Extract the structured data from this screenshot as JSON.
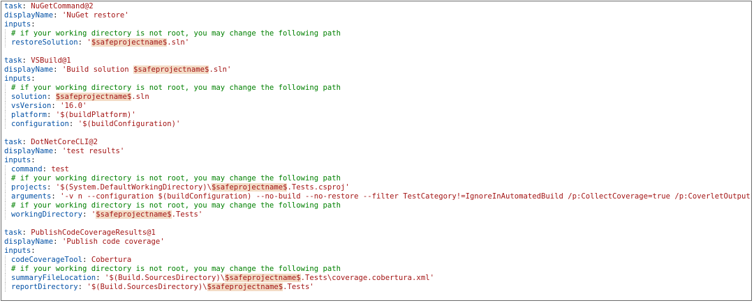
{
  "code_lines": [
    [
      {
        "t": "k",
        "v": "task"
      },
      {
        "t": "p",
        "v": ": "
      },
      {
        "t": "s",
        "v": "NuGetCommand@2"
      }
    ],
    [
      {
        "t": "k",
        "v": "displayName"
      },
      {
        "t": "p",
        "v": ": "
      },
      {
        "t": "s",
        "v": "'NuGet restore'"
      }
    ],
    [
      {
        "t": "k",
        "v": "inputs"
      },
      {
        "t": "p",
        "v": ":"
      }
    ],
    [
      {
        "t": "i"
      },
      {
        "t": "c",
        "v": "# if your working directory is not root, you may change the following path"
      }
    ],
    [
      {
        "t": "i"
      },
      {
        "t": "k",
        "v": "restoreSolution"
      },
      {
        "t": "p",
        "v": ": "
      },
      {
        "t": "s",
        "v": "'"
      },
      {
        "t": "v",
        "v": "$safeprojectname$"
      },
      {
        "t": "s",
        "v": ".sln'"
      }
    ],
    [],
    [
      {
        "t": "k",
        "v": "task"
      },
      {
        "t": "p",
        "v": ": "
      },
      {
        "t": "s",
        "v": "VSBuild@1"
      }
    ],
    [
      {
        "t": "k",
        "v": "displayName"
      },
      {
        "t": "p",
        "v": ": "
      },
      {
        "t": "s",
        "v": "'Build solution "
      },
      {
        "t": "v",
        "v": "$safeprojectname$"
      },
      {
        "t": "s",
        "v": ".sln'"
      }
    ],
    [
      {
        "t": "k",
        "v": "inputs"
      },
      {
        "t": "p",
        "v": ":"
      }
    ],
    [
      {
        "t": "i"
      },
      {
        "t": "c",
        "v": "# if your working directory is not root, you may change the following path"
      }
    ],
    [
      {
        "t": "i"
      },
      {
        "t": "k",
        "v": "solution"
      },
      {
        "t": "p",
        "v": ": "
      },
      {
        "t": "v",
        "v": "$safeprojectname$"
      },
      {
        "t": "s",
        "v": ".sln"
      }
    ],
    [
      {
        "t": "i"
      },
      {
        "t": "k",
        "v": "vsVersion"
      },
      {
        "t": "p",
        "v": ": "
      },
      {
        "t": "s",
        "v": "'16.0'"
      }
    ],
    [
      {
        "t": "i"
      },
      {
        "t": "k",
        "v": "platform"
      },
      {
        "t": "p",
        "v": ": "
      },
      {
        "t": "s",
        "v": "'$(buildPlatform)'"
      }
    ],
    [
      {
        "t": "i"
      },
      {
        "t": "k",
        "v": "configuration"
      },
      {
        "t": "p",
        "v": ": "
      },
      {
        "t": "s",
        "v": "'$(buildConfiguration)'"
      }
    ],
    [],
    [
      {
        "t": "k",
        "v": "task"
      },
      {
        "t": "p",
        "v": ": "
      },
      {
        "t": "s",
        "v": "DotNetCoreCLI@2"
      }
    ],
    [
      {
        "t": "k",
        "v": "displayName"
      },
      {
        "t": "p",
        "v": ": "
      },
      {
        "t": "s",
        "v": "'test results'"
      }
    ],
    [
      {
        "t": "k",
        "v": "inputs"
      },
      {
        "t": "p",
        "v": ":"
      }
    ],
    [
      {
        "t": "i"
      },
      {
        "t": "k",
        "v": "command"
      },
      {
        "t": "p",
        "v": ": "
      },
      {
        "t": "s",
        "v": "test"
      }
    ],
    [
      {
        "t": "i"
      },
      {
        "t": "c",
        "v": "# if your working directory is not root, you may change the following path"
      }
    ],
    [
      {
        "t": "i"
      },
      {
        "t": "k",
        "v": "projects"
      },
      {
        "t": "p",
        "v": ": "
      },
      {
        "t": "s",
        "v": "'$(System.DefaultWorkingDirectory)\\"
      },
      {
        "t": "v",
        "v": "$safeprojectname$"
      },
      {
        "t": "s",
        "v": ".Tests.csproj'"
      }
    ],
    [
      {
        "t": "i"
      },
      {
        "t": "k",
        "v": "arguments"
      },
      {
        "t": "p",
        "v": ": "
      },
      {
        "t": "s",
        "v": "'-v n --configuration $(buildConfiguration) --no-build --no-restore --filter TestCategory!=IgnoreInAutomatedBuild /p:CollectCoverage=true /p:CoverletOutputFormat=cobertura'"
      }
    ],
    [
      {
        "t": "i"
      },
      {
        "t": "c",
        "v": "# if your working directory is not root, you may change the following path"
      }
    ],
    [
      {
        "t": "i"
      },
      {
        "t": "k",
        "v": "workingDirectory"
      },
      {
        "t": "p",
        "v": ": "
      },
      {
        "t": "s",
        "v": "'"
      },
      {
        "t": "v",
        "v": "$safeprojectname$"
      },
      {
        "t": "s",
        "v": ".Tests'"
      }
    ],
    [],
    [
      {
        "t": "k",
        "v": "task"
      },
      {
        "t": "p",
        "v": ": "
      },
      {
        "t": "s",
        "v": "PublishCodeCoverageResults@1"
      }
    ],
    [
      {
        "t": "k",
        "v": "displayName"
      },
      {
        "t": "p",
        "v": ": "
      },
      {
        "t": "s",
        "v": "'Publish code coverage'"
      }
    ],
    [
      {
        "t": "k",
        "v": "inputs"
      },
      {
        "t": "p",
        "v": ":"
      }
    ],
    [
      {
        "t": "i"
      },
      {
        "t": "k",
        "v": "codeCoverageTool"
      },
      {
        "t": "p",
        "v": ": "
      },
      {
        "t": "s",
        "v": "Cobertura"
      }
    ],
    [
      {
        "t": "i"
      },
      {
        "t": "c",
        "v": "# if your working directory is not root, you may change the following path"
      }
    ],
    [
      {
        "t": "i"
      },
      {
        "t": "k",
        "v": "summaryFileLocation"
      },
      {
        "t": "p",
        "v": ": "
      },
      {
        "t": "s",
        "v": "'$(Build.SourcesDirectory)\\"
      },
      {
        "t": "v",
        "v": "$safeprojectname$"
      },
      {
        "t": "s",
        "v": ".Tests\\coverage.cobertura.xml'"
      }
    ],
    [
      {
        "t": "i"
      },
      {
        "t": "k",
        "v": "reportDirectory"
      },
      {
        "t": "p",
        "v": ": "
      },
      {
        "t": "s",
        "v": "'$(Build.SourcesDirectory)\\"
      },
      {
        "t": "v",
        "v": "$safeprojectname$"
      },
      {
        "t": "s",
        "v": ".Tests'"
      }
    ]
  ],
  "colors": {
    "key": "#0451a5",
    "string": "#a31515",
    "comment": "#008000",
    "variable_highlight": "#f3dcc6",
    "indent_guide": "#b8b8b8",
    "border": "#6b6b6b"
  }
}
